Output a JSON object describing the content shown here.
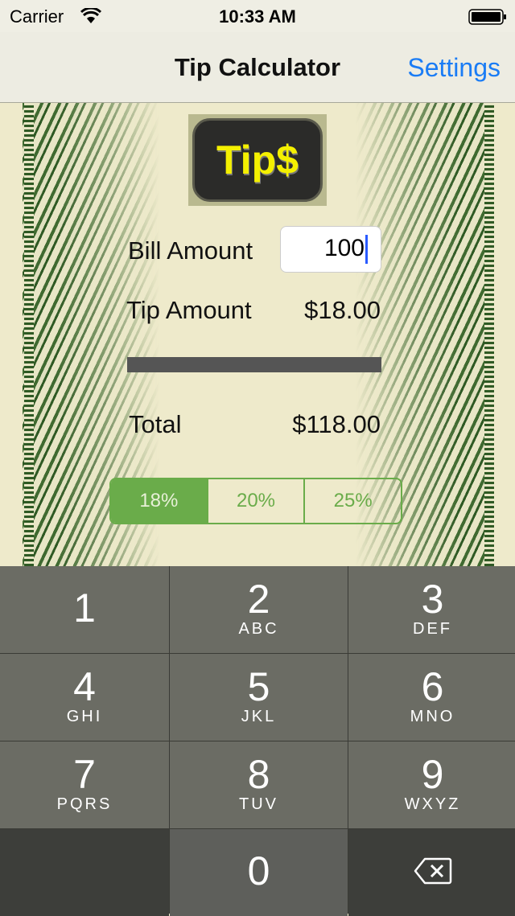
{
  "status": {
    "carrier": "Carrier",
    "time": "10:33 AM"
  },
  "nav": {
    "title": "Tip Calculator",
    "settings": "Settings"
  },
  "logo": "Tip$",
  "bill": {
    "label": "Bill Amount",
    "value": "100"
  },
  "tip": {
    "label": "Tip Amount",
    "value": "$18.00"
  },
  "total": {
    "label": "Total",
    "value": "$118.00"
  },
  "segments": [
    {
      "label": "18%",
      "selected": true
    },
    {
      "label": "20%",
      "selected": false
    },
    {
      "label": "25%",
      "selected": false
    }
  ],
  "keys": [
    {
      "n": "1",
      "s": ""
    },
    {
      "n": "2",
      "s": "ABC"
    },
    {
      "n": "3",
      "s": "DEF"
    },
    {
      "n": "4",
      "s": "GHI"
    },
    {
      "n": "5",
      "s": "JKL"
    },
    {
      "n": "6",
      "s": "MNO"
    },
    {
      "n": "7",
      "s": "PQRS"
    },
    {
      "n": "8",
      "s": "TUV"
    },
    {
      "n": "9",
      "s": "WXYZ"
    },
    {
      "n": "0",
      "s": ""
    }
  ],
  "colors": {
    "accent": "#6aac4a",
    "link": "#1a7cf5"
  }
}
